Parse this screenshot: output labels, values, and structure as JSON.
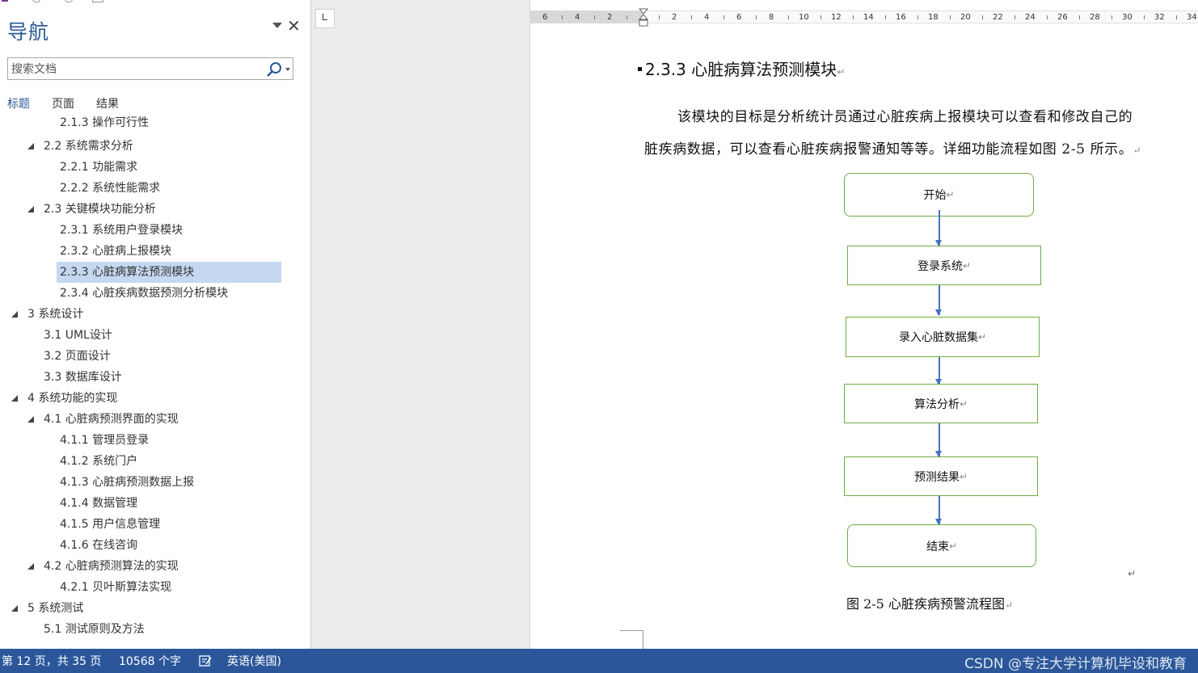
{
  "nav": {
    "title": "导航",
    "search_placeholder": "搜索文档",
    "tabs": [
      "标题",
      "页面",
      "结果"
    ],
    "outline": [
      {
        "text": "2.1.3 操作可行性",
        "level": 3,
        "partial": true
      },
      {
        "text": "2.2 系统需求分析",
        "level": 2,
        "expanded": true
      },
      {
        "text": "2.2.1 功能需求",
        "level": 3
      },
      {
        "text": "2.2.2 系统性能需求",
        "level": 3
      },
      {
        "text": "2.3 关键模块功能分析",
        "level": 2,
        "expanded": true
      },
      {
        "text": "2.3.1 系统用户登录模块",
        "level": 3
      },
      {
        "text": "2.3.2 心脏病上报模块",
        "level": 3
      },
      {
        "text": "2.3.3 心脏病算法预测模块",
        "level": 3,
        "selected": true
      },
      {
        "text": "2.3.4 心脏疾病数据预测分析模块",
        "level": 3
      },
      {
        "text": "3 系统设计",
        "level": 1,
        "expanded": true
      },
      {
        "text": "3.1 UML设计",
        "level": 2
      },
      {
        "text": "3.2 页面设计",
        "level": 2
      },
      {
        "text": "3.3 数据库设计",
        "level": 2
      },
      {
        "text": "4 系统功能的实现",
        "level": 1,
        "expanded": true
      },
      {
        "text": "4.1 心脏病预测界面的实现",
        "level": 2,
        "expanded": true
      },
      {
        "text": "4.1.1 管理员登录",
        "level": 3
      },
      {
        "text": "4.1.2 系统门户",
        "level": 3
      },
      {
        "text": "4.1.3 心脏病预测数据上报",
        "level": 3
      },
      {
        "text": "4.1.4 数据管理",
        "level": 3
      },
      {
        "text": "4.1.5 用户信息管理",
        "level": 3
      },
      {
        "text": "4.1.6 在线咨询",
        "level": 3
      },
      {
        "text": "4.2 心脏病预测算法的实现",
        "level": 2,
        "expanded": true
      },
      {
        "text": "4.2.1 贝叶斯算法实现",
        "level": 3
      },
      {
        "text": "5 系统测试",
        "level": 1,
        "expanded": true
      },
      {
        "text": "5.1 测试原则及方法",
        "level": 2
      }
    ]
  },
  "ruler": {
    "left_numbers": [
      "6",
      "4",
      "2"
    ],
    "right_numbers": [
      "2",
      "4",
      "6",
      "8",
      "10",
      "12",
      "14",
      "16",
      "18",
      "20",
      "22",
      "24",
      "26",
      "28",
      "30",
      "32",
      "34"
    ]
  },
  "document": {
    "heading": "2.3.3  心脏病算法预测模块",
    "para_line1": "该模块的目标是分析统计员通过心脏疾病上报模块可以查看和修改自己的",
    "para_line2": "脏疾病数据，可以查看心脏疾病报警通知等等。详细功能流程如图 2-5  所示。",
    "flowchart": [
      "开始",
      "登录系统",
      "录入心脏数据集",
      "算法分析",
      "预测结果",
      "结束"
    ],
    "caption": "图 2-5  心脏疾病预警流程图",
    "paragraph_mark": "↵"
  },
  "status": {
    "page": "第 12 页，共 35 页",
    "words": "10568 个字",
    "language": "英语(美国)",
    "watermark": "CSDN @专注大学计算机毕设和教育"
  },
  "colors": {
    "accent": "#2b579a",
    "selection": "#c5d8f1",
    "box_border": "#70ad47",
    "arrow": "#4472c4"
  }
}
